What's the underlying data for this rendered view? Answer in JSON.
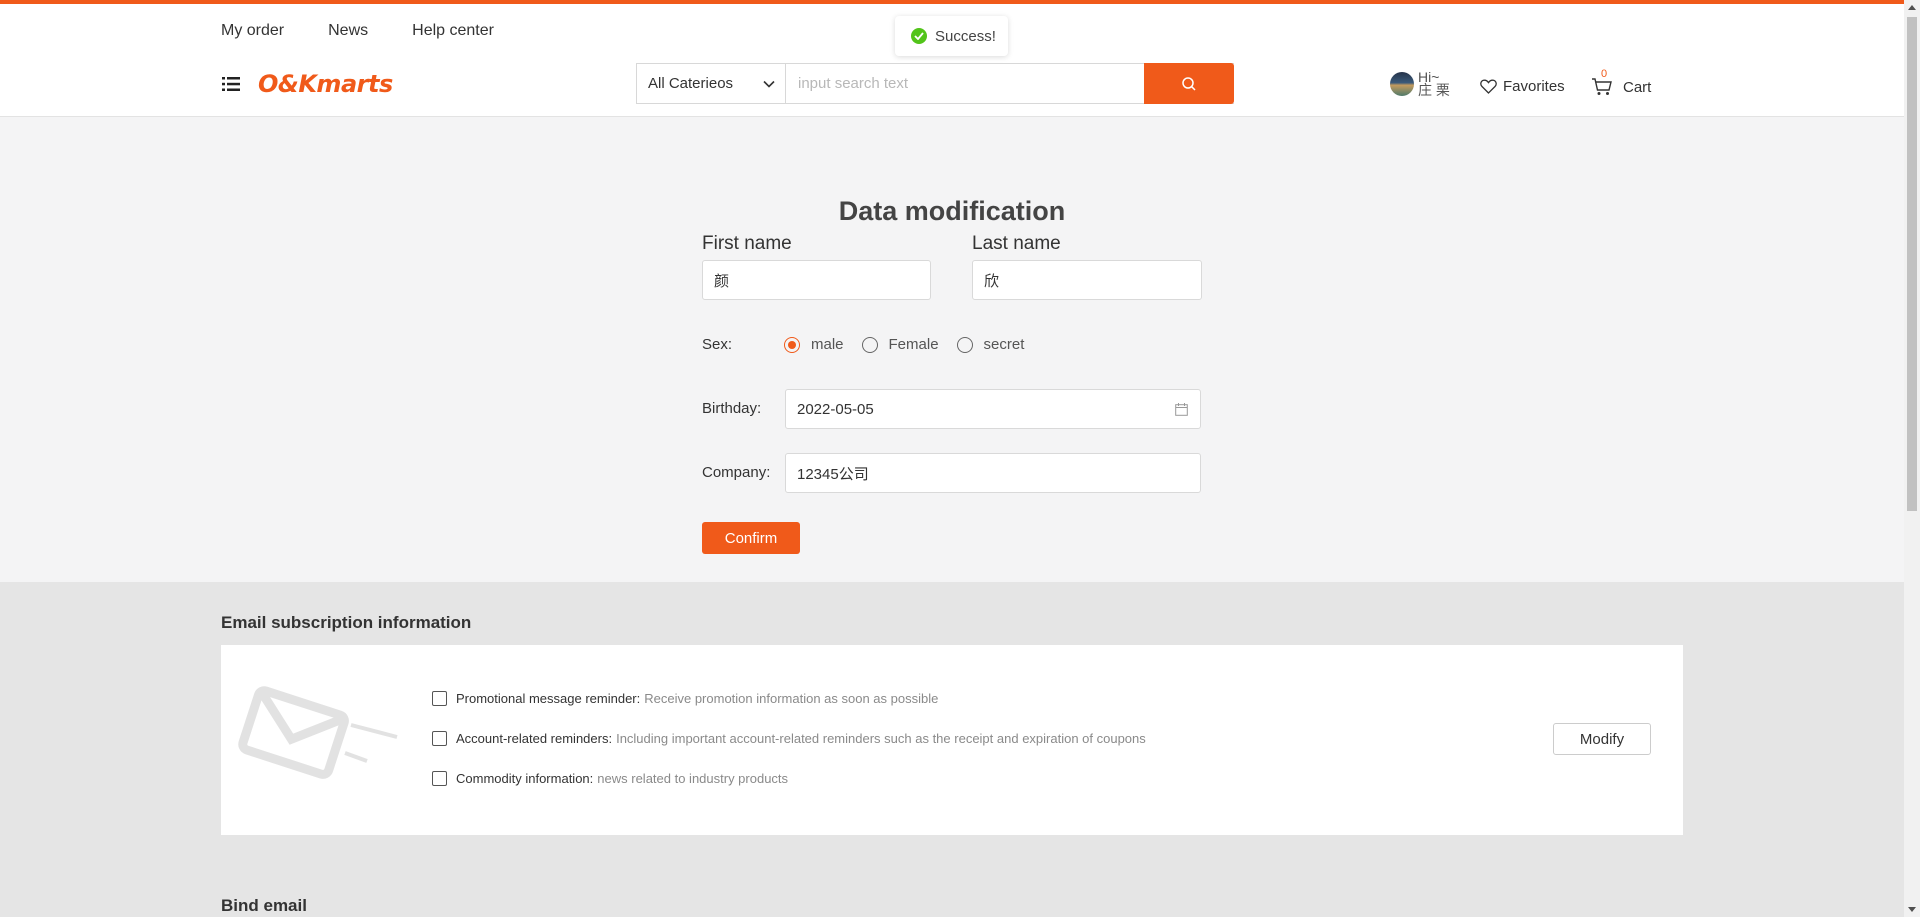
{
  "nav": {
    "links": [
      "My order",
      "News",
      "Help center"
    ]
  },
  "brand": {
    "logo_text": "O&Kmarts",
    "accent": "#f05a1a"
  },
  "search": {
    "category": "All Caterieos",
    "placeholder": "input search text"
  },
  "user": {
    "greeting": "Hi~",
    "name": "庄 栗"
  },
  "header_actions": {
    "favorites": "Favorites",
    "cart": "Cart",
    "cart_count": "0"
  },
  "toast": {
    "text": "Success!"
  },
  "form": {
    "title": "Data modification",
    "first_name_label": "First name",
    "first_name_value": "颜",
    "last_name_label": "Last name",
    "last_name_value": "欣",
    "sex_label": "Sex:",
    "sex_options": [
      "male",
      "Female",
      "secret"
    ],
    "sex_selected": "male",
    "birthday_label": "Birthday:",
    "birthday_value": "2022-05-05",
    "company_label": "Company:",
    "company_value": "12345公司",
    "confirm": "Confirm"
  },
  "email_subscription": {
    "title": "Email subscription information",
    "items": [
      {
        "name": "Promotional message reminder:",
        "desc": "Receive promotion information as soon as possible",
        "checked": false
      },
      {
        "name": "Account-related reminders:",
        "desc": "Including important account-related reminders such as the receipt and expiration of coupons",
        "checked": false
      },
      {
        "name": "Commodity information:",
        "desc": "news related to industry products",
        "checked": false
      }
    ],
    "modify": "Modify"
  },
  "bind_email": {
    "title": "Bind email"
  }
}
